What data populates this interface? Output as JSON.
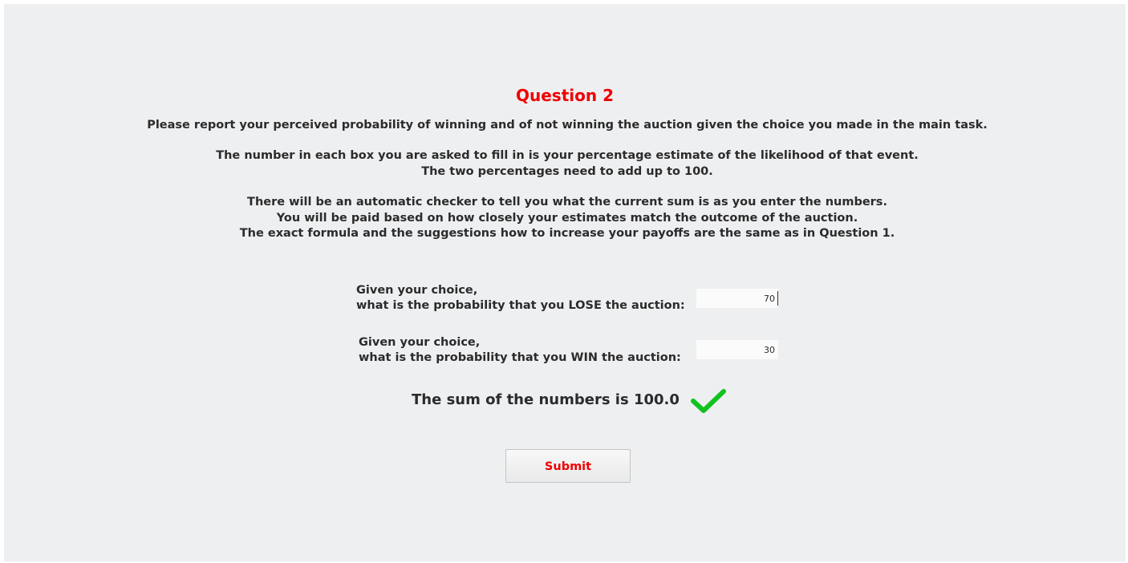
{
  "title": "Question 2",
  "instructions": {
    "line1": "Please report your perceived probability of winning and of not winning the auction given the choice you made in the main task.",
    "line2": "The number in each box you are asked to fill in is your percentage estimate of the likelihood of that event.\nThe two percentages need to add up to 100.",
    "line3": "There will be an automatic checker to tell you what the current sum is as you enter the numbers.\nYou will be paid based on how closely your estimates match the outcome of the auction.\nThe exact formula and the suggestions how to increase your payoffs are the same as in Question 1."
  },
  "lose_question": {
    "label": "Given your choice,\nwhat is the probability that you LOSE the auction:",
    "value": "70"
  },
  "win_question": {
    "label": "Given your choice,\nwhat is the probability that you WIN the auction:",
    "value": "30"
  },
  "sum": {
    "text": "The sum of the numbers is 100.0",
    "status_icon": "check-icon",
    "status_color": "#11c21e"
  },
  "submit": {
    "label": "Submit"
  },
  "colors": {
    "accent": "#f00000",
    "background": "#eeeff1",
    "text": "#2b2b2b"
  }
}
